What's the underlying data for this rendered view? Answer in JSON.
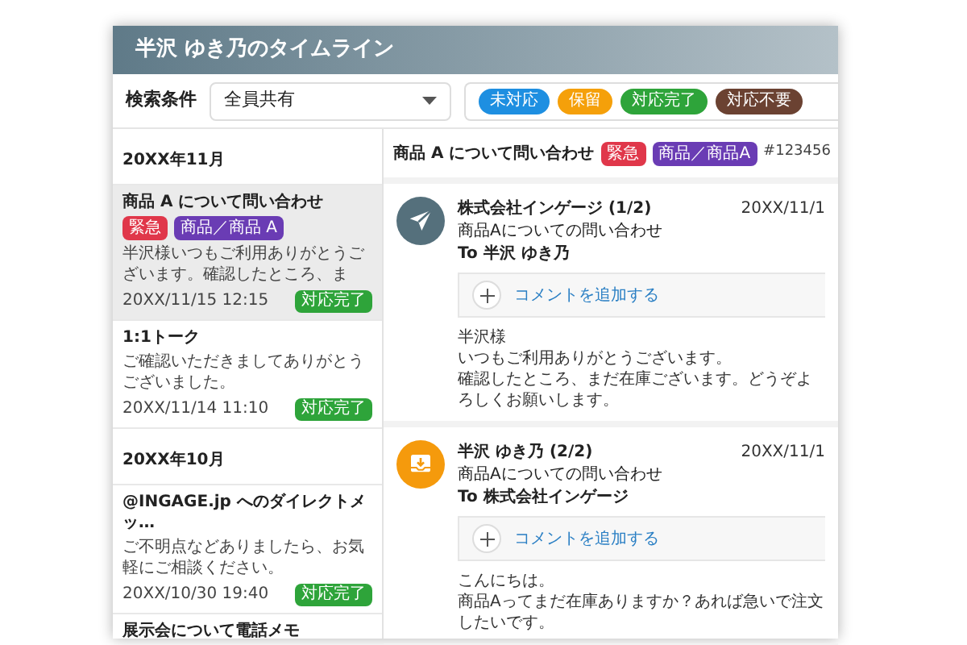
{
  "window": {
    "title": "半沢 ゆき乃のタイムライン"
  },
  "filter": {
    "label": "検索条件",
    "select": {
      "value": "全員共有"
    },
    "statuses": [
      {
        "label": "未対応",
        "color": "#1e8fe1"
      },
      {
        "label": "保留",
        "color": "#f5a00a"
      },
      {
        "label": "対応完了",
        "color": "#2ea43a"
      },
      {
        "label": "対応不要",
        "color": "#6b4232"
      }
    ]
  },
  "timeline": {
    "groups": [
      {
        "heading": "20XX年11月",
        "items": [
          {
            "title": "商品 A について問い合わせ",
            "tags": [
              {
                "label": "緊急",
                "color": "#e0374a"
              },
              {
                "label": "商品／商品 A",
                "color": "#6a3cb4"
              }
            ],
            "preview": "半沢様いつもご利用ありがとうございます。確認したところ、ま",
            "time": "20XX/11/15 12:15",
            "status": "対応完了",
            "selected": true
          },
          {
            "title": "1:1トーク",
            "preview": "ご確認いただきましてありがとうございました。",
            "time": "20XX/11/14 11:10",
            "status": "対応完了",
            "selected": false
          }
        ]
      },
      {
        "heading": "20XX年10月",
        "items": [
          {
            "title": "@INGAGE.jp へのダイレクトメッ…",
            "preview": "ご不明点などありましたら、お気軽にご相談ください。",
            "time": "20XX/10/30 19:40",
            "status": "対応完了",
            "selected": false
          },
          {
            "title": "展示会について電話メモ",
            "selected": false
          }
        ]
      }
    ]
  },
  "thread": {
    "title": "商品 A について問い合わせ",
    "tags": [
      {
        "label": "緊急",
        "color": "#e0374a"
      },
      {
        "label": "商品／商品A",
        "color": "#6a3cb4"
      }
    ],
    "number": "#123456",
    "messages": [
      {
        "kind": "sent",
        "sender": "株式会社インゲージ",
        "count": "(1/2)",
        "date": "20XX/11/1",
        "subject": "商品Aについての問い合わせ",
        "to": "To 半沢 ゆき乃",
        "comment_action": "コメントを追加する",
        "body": [
          "半沢様",
          "いつもご利用ありがとうございます。",
          "確認したところ、まだ在庫ございます。どうぞよろしくお願いします。"
        ]
      },
      {
        "kind": "received",
        "sender": "半沢 ゆき乃",
        "count": "(2/2)",
        "date": "20XX/11/1",
        "subject": "商品Aについての問い合わせ",
        "to": "To 株式会社インゲージ",
        "comment_action": "コメントを追加する",
        "body": [
          "こんにちは。",
          "商品Aってまだ在庫ありますか？あれば急いで注文したいです。"
        ]
      }
    ]
  }
}
